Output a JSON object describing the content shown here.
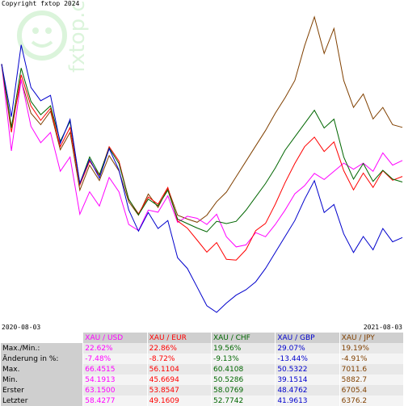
{
  "copyright": "Copyright fxtop 2024",
  "watermark": "fxtop.com",
  "chart_data": {
    "type": "line",
    "x_start": "2020-08-03",
    "x_end": "2021-08-03",
    "series": [
      {
        "name": "XAU / USD",
        "color": "#ff00ff",
        "values": [
          63.15,
          58.9,
          62.4,
          60.1,
          59.3,
          59.8,
          57.9,
          58.6,
          55.8,
          56.9,
          56.2,
          57.6,
          56.9,
          55.3,
          55.0,
          56.0,
          55.9,
          56.7,
          55.4,
          55.7,
          55.6,
          55.3,
          55.8,
          54.7,
          54.2,
          54.3,
          54.9,
          54.7,
          55.3,
          56.0,
          56.8,
          57.2,
          57.8,
          57.5,
          57.9,
          58.3,
          58.0,
          58.3,
          57.9,
          58.8,
          58.2,
          58.43
        ]
      },
      {
        "name": "XAU / EUR",
        "color": "#ff0000",
        "values": [
          53.85,
          51.0,
          53.4,
          52.1,
          51.5,
          52.0,
          50.4,
          51.2,
          48.8,
          49.8,
          49.2,
          50.4,
          49.8,
          48.2,
          47.6,
          48.3,
          48.0,
          48.7,
          47.3,
          47.0,
          46.5,
          46.0,
          46.4,
          45.7,
          45.67,
          46.1,
          46.9,
          47.2,
          48.0,
          48.9,
          49.7,
          50.4,
          50.8,
          50.2,
          50.6,
          49.4,
          48.6,
          49.3,
          48.7,
          49.4,
          49.0,
          49.16
        ]
      },
      {
        "name": "XAU / CHF",
        "color": "#006600",
        "values": [
          58.08,
          55.2,
          57.9,
          56.4,
          55.8,
          56.2,
          54.6,
          55.5,
          52.7,
          53.9,
          53.1,
          54.3,
          53.6,
          52.0,
          51.3,
          52.0,
          51.7,
          52.4,
          51.1,
          50.9,
          50.7,
          50.53,
          51.0,
          50.9,
          51.0,
          51.5,
          52.1,
          52.7,
          53.4,
          54.2,
          54.8,
          55.4,
          56.0,
          55.2,
          55.6,
          53.9,
          52.9,
          53.6,
          52.8,
          53.3,
          52.9,
          52.77
        ]
      },
      {
        "name": "XAU / GBP",
        "color": "#0000cc",
        "values": [
          48.48,
          46.5,
          49.2,
          47.6,
          47.1,
          47.3,
          45.5,
          46.4,
          44.0,
          44.9,
          44.2,
          45.3,
          44.5,
          43.0,
          42.2,
          42.9,
          42.3,
          42.6,
          41.2,
          40.8,
          40.1,
          39.4,
          39.15,
          39.5,
          39.8,
          40.0,
          40.3,
          40.8,
          41.4,
          42.0,
          42.6,
          43.4,
          44.1,
          42.9,
          43.2,
          42.1,
          41.4,
          42.0,
          41.5,
          42.3,
          41.8,
          41.96
        ]
      },
      {
        "name": "XAU / JPY",
        "color": "#804000",
        "values": [
          6705.4,
          6380,
          6620,
          6450,
          6390,
          6460,
          6260,
          6350,
          6050,
          6180,
          6100,
          6230,
          6150,
          5990,
          5920,
          6030,
          5960,
          6060,
          5920,
          5900,
          5883,
          5920,
          5990,
          6040,
          6120,
          6200,
          6280,
          6360,
          6450,
          6530,
          6620,
          6800,
          6950,
          6760,
          6890,
          6620,
          6480,
          6550,
          6420,
          6480,
          6390,
          6376.2
        ]
      }
    ]
  },
  "dates": {
    "start": "2020-08-03",
    "end": "2021-08-03"
  },
  "table": {
    "headers": [
      "XAU / USD",
      "XAU / EUR",
      "XAU / CHF",
      "XAU / GBP",
      "XAU / JPY"
    ],
    "colors": [
      "#ff00ff",
      "#ff0000",
      "#006600",
      "#0000cc",
      "#804000"
    ],
    "rows": [
      {
        "label": "Max./Min.:",
        "values": [
          "22.62%",
          "22.86%",
          "19.56%",
          "29.07%",
          "19.19%"
        ]
      },
      {
        "label": "Änderung in %:",
        "values": [
          "-7.48%",
          "-8.72%",
          "-9.13%",
          "-13.44%",
          "-4.91%"
        ]
      },
      {
        "label": "Max.",
        "values": [
          "66.4515",
          "56.1104",
          "60.4108",
          "50.5322",
          "7011.6"
        ]
      },
      {
        "label": "Min.",
        "values": [
          "54.1913",
          "45.6694",
          "50.5286",
          "39.1514",
          "5882.7"
        ]
      },
      {
        "label": "Erster",
        "values": [
          "63.1500",
          "53.8547",
          "58.0769",
          "48.4762",
          "6705.4"
        ]
      },
      {
        "label": "Letzter",
        "values": [
          "58.4277",
          "49.1609",
          "52.7742",
          "41.9613",
          "6376.2"
        ]
      }
    ]
  }
}
